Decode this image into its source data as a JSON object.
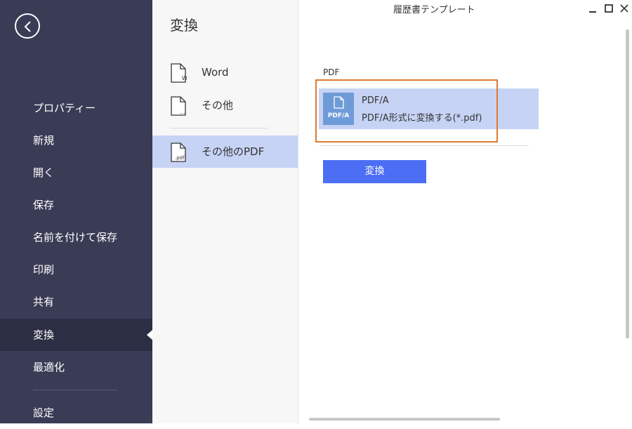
{
  "window": {
    "title": "履歴書テンプレート"
  },
  "sidebar": {
    "items": [
      {
        "label": "プロパティー"
      },
      {
        "label": "新規"
      },
      {
        "label": "開く"
      },
      {
        "label": "保存"
      },
      {
        "label": "名前を付けて保存"
      },
      {
        "label": "印刷"
      },
      {
        "label": "共有"
      },
      {
        "label": "変換",
        "active": true
      },
      {
        "label": "最適化"
      },
      {
        "label": "設定"
      }
    ]
  },
  "convert_pane": {
    "title": "変換",
    "items": [
      {
        "label": "Word",
        "icon_glyph": "W"
      },
      {
        "label": "その他",
        "icon_glyph": "..."
      },
      {
        "label": "その他のPDF",
        "icon_glyph": ".pdf",
        "active": true
      }
    ]
  },
  "content": {
    "section_label": "PDF",
    "option": {
      "icon_text": "PDF/A",
      "title": "PDF/A",
      "description": "PDF/A形式に変換する(*.pdf)"
    },
    "convert_button": "変換"
  },
  "colors": {
    "sidebar_bg": "#3a3c56",
    "selected_bg": "#c6d3f5",
    "accent_button": "#4c6ef5",
    "highlight_border": "#e07a30",
    "pdf_icon": "#6e9bd8"
  }
}
